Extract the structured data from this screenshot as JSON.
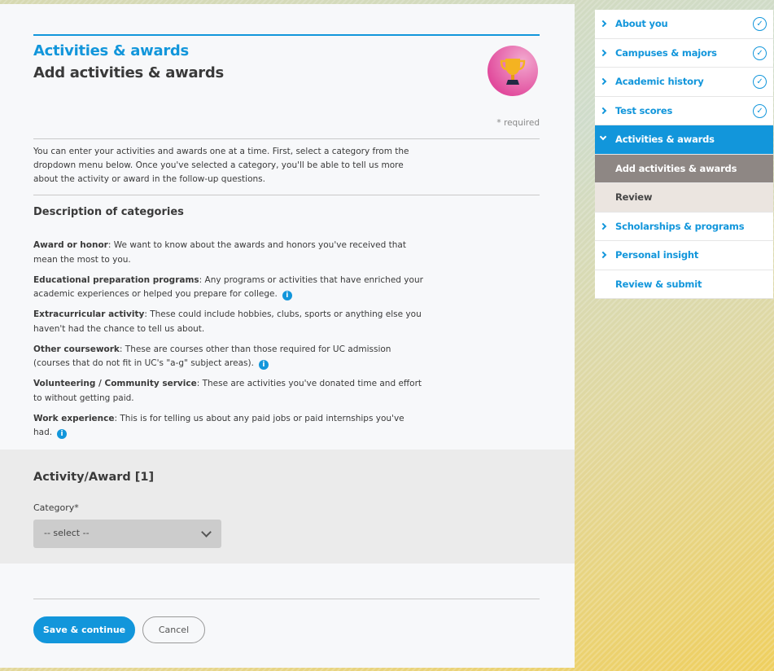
{
  "header": {
    "section": "Activities & awards",
    "title": "Add activities & awards",
    "required_note": "* required",
    "icon": "trophy-icon"
  },
  "intro": "You can enter your activities and awards one at a time. First, select a category from the dropdown menu below. Once you've selected a category, you'll be able to tell us more about the activity or award in the follow-up questions.",
  "description": {
    "heading": "Description of categories",
    "items": [
      {
        "term": "Award or honor",
        "text": ": We want to know about the awards and honors you've received that mean the most to you.",
        "info": false
      },
      {
        "term": "Educational preparation programs",
        "text": ": Any programs or activities that have enriched your academic experiences or helped you prepare for college.",
        "info": true
      },
      {
        "term": "Extracurricular activity",
        "text": ": These could include hobbies, clubs, sports or anything else you haven't had the chance to tell us about.",
        "info": false
      },
      {
        "term": "Other coursework",
        "text": ": These are courses other than those required for UC admission (courses that do not fit in UC's \"a-g\" subject areas).",
        "info": true
      },
      {
        "term": "Volunteering / Community service",
        "text": ": These are activities you've donated time and effort to without getting paid.",
        "info": false
      },
      {
        "term": "Work experience",
        "text": ": This is for telling us about any paid jobs or paid internships you've had.",
        "info": true
      }
    ]
  },
  "form": {
    "heading": "Activity/Award [1]",
    "category_label": "Category*",
    "category_value": "-- select --"
  },
  "buttons": {
    "save": "Save & continue",
    "cancel": "Cancel"
  },
  "sidebar": {
    "items": [
      {
        "label": "About you",
        "done": true,
        "arrow": true
      },
      {
        "label": "Campuses & majors",
        "done": true,
        "arrow": true
      },
      {
        "label": "Academic history",
        "done": true,
        "arrow": true
      },
      {
        "label": "Test scores",
        "done": true,
        "arrow": true
      },
      {
        "label": "Activities & awards",
        "state": "active",
        "arrow": true
      },
      {
        "label": "Add activities & awards",
        "state": "current-sub"
      },
      {
        "label": "Review",
        "state": "sub"
      },
      {
        "label": "Scholarships & programs",
        "arrow": true
      },
      {
        "label": "Personal insight",
        "arrow": true
      },
      {
        "label": "Review & submit"
      }
    ]
  },
  "colors": {
    "accent": "#1296db",
    "active_sub": "#8e8784",
    "sub": "#ebe5e0"
  }
}
